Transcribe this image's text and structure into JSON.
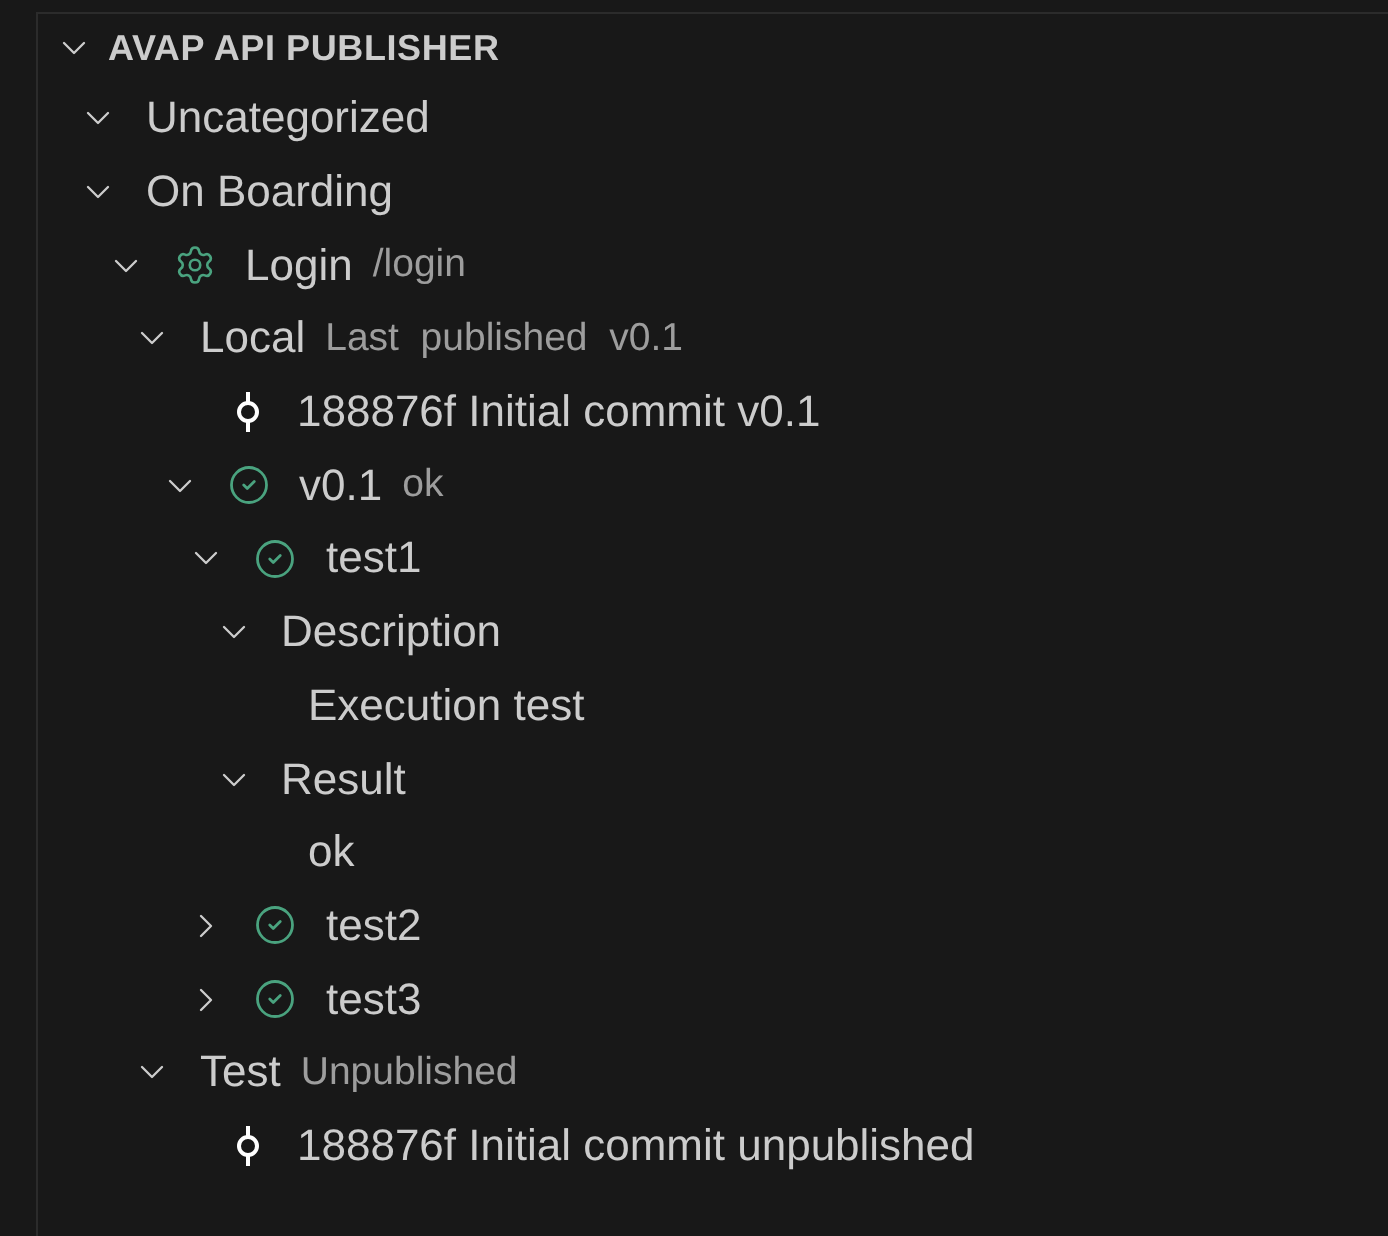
{
  "panel": {
    "title": "AVAP API PUBLISHER",
    "expanded": true
  },
  "tree": [
    {
      "label": "Uncategorized",
      "expanded": true
    },
    {
      "label": "On Boarding",
      "expanded": true,
      "children": [
        {
          "label": "Login",
          "description": "/login",
          "kind": "endpoint",
          "expanded": true,
          "children": [
            {
              "label": "Local",
              "description": "Last  published  v0.1",
              "expanded": true,
              "children": [
                {
                  "label": "188876f Initial commit v0.1",
                  "kind": "commit"
                },
                {
                  "label": "v0.1",
                  "description": "ok",
                  "kind": "passed",
                  "expanded": true,
                  "children": [
                    {
                      "label": "test1",
                      "kind": "passed",
                      "expanded": true,
                      "children": [
                        {
                          "label": "Description",
                          "expanded": true,
                          "children": [
                            {
                              "label": "Execution test"
                            }
                          ]
                        },
                        {
                          "label": "Result",
                          "expanded": true,
                          "children": [
                            {
                              "label": "ok"
                            }
                          ]
                        }
                      ]
                    },
                    {
                      "label": "test2",
                      "kind": "passed",
                      "expanded": false
                    },
                    {
                      "label": "test3",
                      "kind": "passed",
                      "expanded": false
                    }
                  ]
                }
              ]
            },
            {
              "label": "Test",
              "description": "Unpublished",
              "expanded": true,
              "children": [
                {
                  "label": "188876f Initial commit unpublished",
                  "kind": "commit"
                }
              ]
            }
          ]
        }
      ]
    }
  ]
}
